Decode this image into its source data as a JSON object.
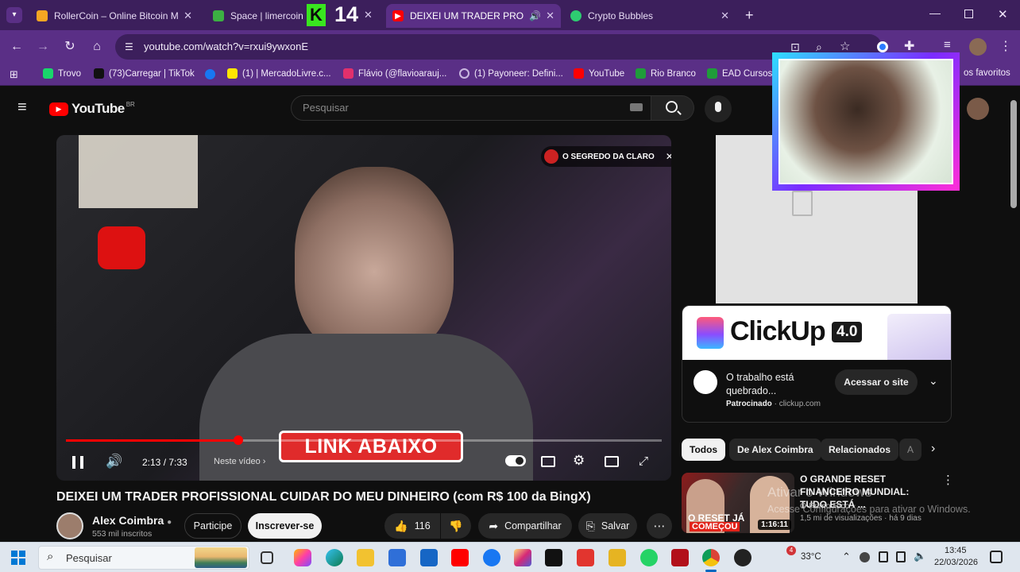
{
  "browser": {
    "tabs": [
      {
        "label": "RollerCoin – Online Bitcoin Mi",
        "favicon_color": "#f5a623"
      },
      {
        "label": "Space | limercoin.c",
        "favicon_color": "#3cb043"
      },
      {
        "label": "DEIXEI UM TRADER PROFIS",
        "favicon_color": "#ff0000"
      },
      {
        "label": "Crypto Bubbles",
        "favicon_color": "#2ecc71"
      }
    ],
    "overlay_badge": "14",
    "url": "youtube.com/watch?v=rxui9ywxonE",
    "bookmarks": [
      {
        "label": "Trovo",
        "color": "#19d66b"
      },
      {
        "label": "(73)Carregar | TikTok",
        "color": "#111111"
      },
      {
        "label": "(1) | MercadoLivre.c...",
        "color": "#ffe600"
      },
      {
        "label": "Flávio (@flavioarauj...",
        "color": "#e1306c"
      },
      {
        "label": "(1) Payoneer: Defini...",
        "color": "#8e8e8e"
      },
      {
        "label": "YouTube",
        "color": "#ff0000"
      },
      {
        "label": "Rio Branco",
        "color": "#1f9c3a"
      },
      {
        "label": "EAD Cursos c",
        "color": "#1f9c3a"
      }
    ],
    "bookmarks_more": "os favoritos"
  },
  "youtube": {
    "logo_text": "YouTube",
    "logo_region": "BR",
    "search_placeholder": "Pesquisar",
    "player": {
      "promo_chip": "O SEGREDO DA CLARO",
      "banner_text": "LINK ABAIXO",
      "time": "2:13 / 7:33",
      "chapter": "Neste vídeo",
      "progress": 0.29
    },
    "video_title": "DEIXEI UM TRADER PROFISSIONAL CUIDAR DO MEU DINHEIRO (com R$ 100 da BingX)",
    "channel": {
      "name": "Alex Coimbra",
      "subs": "553 mil inscritos"
    },
    "actions": {
      "join": "Participe",
      "subscribe": "Inscrever-se",
      "likes": "116",
      "share": "Compartilhar",
      "save": "Salvar"
    },
    "ad": {
      "brand": "ClickUp",
      "version": "4.0",
      "headline": "O trabalho está quebrado...",
      "sponsored": "Patrocinado",
      "domain": "clickup.com",
      "cta": "Acessar o site"
    },
    "chips": [
      "Todos",
      "De Alex Coimbra",
      "Relacionados",
      "A"
    ],
    "recommendation": {
      "title": "O GRANDE RESET FINANCEIRO MUNDIAL: TUDO ESTÁ ...",
      "channel": "O Primo Rico",
      "meta": "1,5 mi de visualizações · há 9 dias",
      "duration": "1:16:11",
      "thumb_text_1": "O RESET JÁ",
      "thumb_text_2": "COMEÇOU"
    },
    "watermark_1": "Ativar o Windows",
    "watermark_2": "Acesse Configurações para ativar o Windows."
  },
  "taskbar": {
    "search_placeholder": "Pesquisar",
    "weather": "33°C",
    "time": "13:45",
    "date": "22/03/2026",
    "notification_count": "4",
    "colors": {
      "accent": "#5a2f86"
    }
  }
}
